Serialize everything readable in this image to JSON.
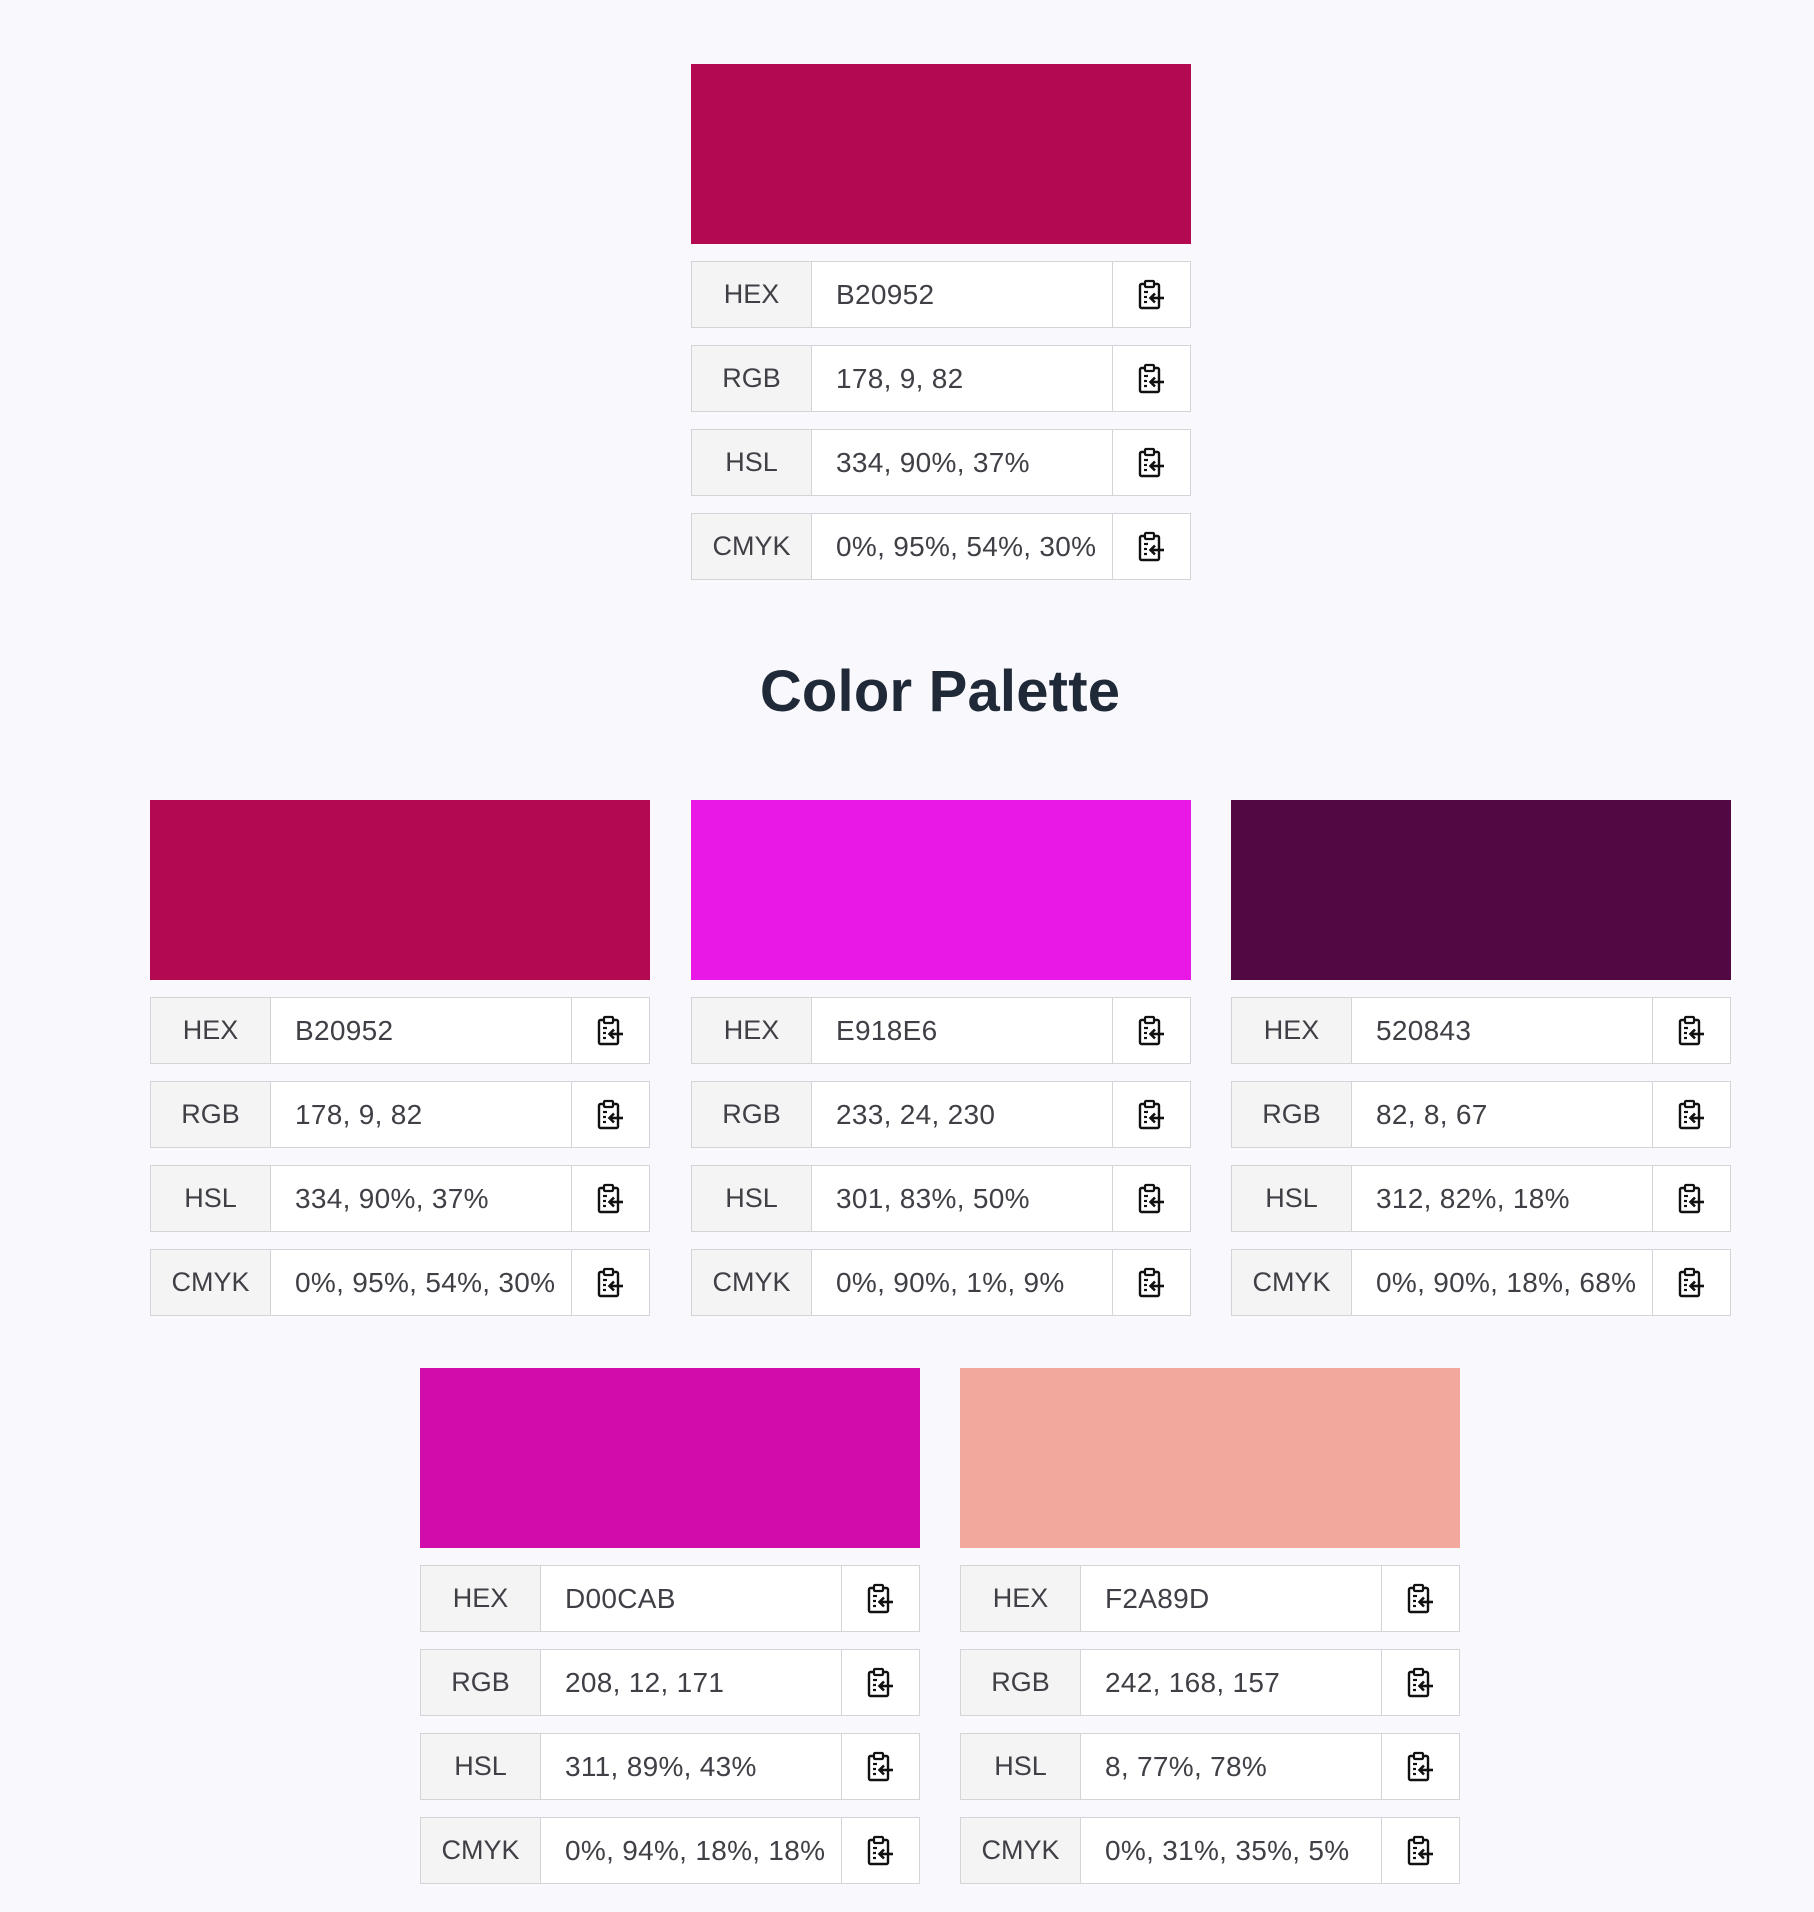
{
  "hero": {
    "color": "#B20952",
    "rows": [
      {
        "label": "HEX",
        "value": "B20952"
      },
      {
        "label": "RGB",
        "value": "178, 9, 82"
      },
      {
        "label": "HSL",
        "value": "334, 90%, 37%"
      },
      {
        "label": "CMYK",
        "value": "0%, 95%, 54%, 30%"
      }
    ]
  },
  "palette_title": "Color Palette",
  "palette": [
    {
      "color": "#B20952",
      "rows": [
        {
          "label": "HEX",
          "value": "B20952"
        },
        {
          "label": "RGB",
          "value": "178, 9, 82"
        },
        {
          "label": "HSL",
          "value": "334, 90%, 37%"
        },
        {
          "label": "CMYK",
          "value": "0%, 95%, 54%, 30%"
        }
      ]
    },
    {
      "color": "#E918E6",
      "rows": [
        {
          "label": "HEX",
          "value": "E918E6"
        },
        {
          "label": "RGB",
          "value": "233, 24, 230"
        },
        {
          "label": "HSL",
          "value": "301, 83%, 50%"
        },
        {
          "label": "CMYK",
          "value": "0%, 90%, 1%, 9%"
        }
      ]
    },
    {
      "color": "#520843",
      "rows": [
        {
          "label": "HEX",
          "value": "520843"
        },
        {
          "label": "RGB",
          "value": "82, 8, 67"
        },
        {
          "label": "HSL",
          "value": "312, 82%, 18%"
        },
        {
          "label": "CMYK",
          "value": "0%, 90%, 18%, 68%"
        }
      ]
    },
    {
      "color": "#D00CAB",
      "rows": [
        {
          "label": "HEX",
          "value": "D00CAB"
        },
        {
          "label": "RGB",
          "value": "208, 12, 171"
        },
        {
          "label": "HSL",
          "value": "311, 89%, 43%"
        },
        {
          "label": "CMYK",
          "value": "0%, 94%, 18%, 18%"
        }
      ]
    },
    {
      "color": "#F2A89D",
      "rows": [
        {
          "label": "HEX",
          "value": "F2A89D"
        },
        {
          "label": "RGB",
          "value": "242, 168, 157"
        },
        {
          "label": "HSL",
          "value": "8, 77%, 78%"
        },
        {
          "label": "CMYK",
          "value": "0%, 31%, 35%, 5%"
        }
      ]
    }
  ],
  "icons": {
    "copy": "clipboard-copy-icon"
  }
}
